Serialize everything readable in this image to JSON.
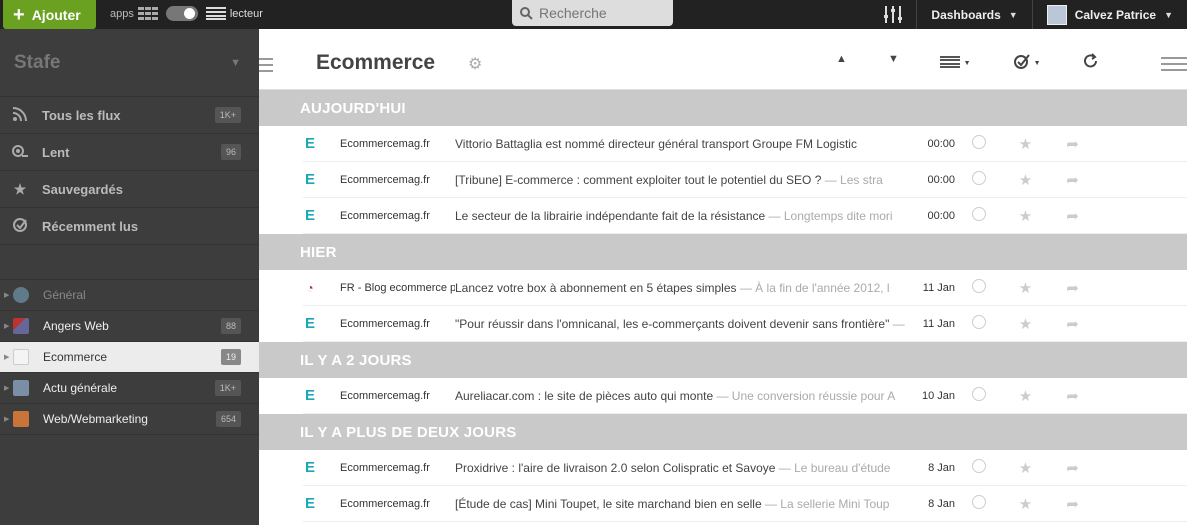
{
  "topbar": {
    "add_label": "Ajouter",
    "apps_label": "apps",
    "reader_label": "lecteur",
    "search_placeholder": "Recherche",
    "dashboards_label": "Dashboards",
    "user_name": "Calvez Patrice"
  },
  "sidebar": {
    "title": "Stafe",
    "nav": [
      {
        "label": "Tous les flux",
        "count": "1K+",
        "icon": "rss-icon"
      },
      {
        "label": "Lent",
        "count": "96",
        "icon": "snail-icon"
      },
      {
        "label": "Sauvegardés",
        "count": "",
        "icon": "star-icon"
      },
      {
        "label": "Récemment lus",
        "count": "",
        "icon": "read-check-icon"
      }
    ],
    "feeds": [
      {
        "label": "Général",
        "count": ""
      },
      {
        "label": "Angers Web",
        "count": "88"
      },
      {
        "label": "Ecommerce",
        "count": "19"
      },
      {
        "label": "Actu générale",
        "count": "1K+"
      },
      {
        "label": "Web/Webmarketing",
        "count": "654"
      }
    ]
  },
  "main": {
    "title": "Ecommerce",
    "sections": [
      {
        "label": "AUJOURD'HUI",
        "rows": [
          {
            "source": "Ecommercemag.fr",
            "title": "Vittorio Battaglia est nommé directeur général transport Groupe FM Logistic",
            "summary": "",
            "time": "00:00"
          },
          {
            "source": "Ecommercemag.fr",
            "title": "[Tribune] E-commerce : comment exploiter tout le potentiel du SEO ?",
            "summary": " — Les stra",
            "time": "00:00"
          },
          {
            "source": "Ecommercemag.fr",
            "title": "Le secteur de la librairie indépendante fait de la résistance",
            "summary": " — Longtemps dite mori",
            "time": "00:00"
          }
        ]
      },
      {
        "label": "HIER",
        "rows": [
          {
            "source": "FR - Blog ecommerce p",
            "title": "Lancez votre box à abonnement en 5 étapes simples",
            "summary": " — À la fin de l'année 2012, l",
            "time": "11 Jan"
          },
          {
            "source": "Ecommercemag.fr",
            "title": "\"Pour réussir dans l'omnicanal, les e-commerçants doivent devenir sans frontière\"",
            "summary": " —",
            "time": "11 Jan"
          }
        ]
      },
      {
        "label": "IL Y A 2 JOURS",
        "rows": [
          {
            "source": "Ecommercemag.fr",
            "title": "Aureliacar.com : le site de pièces auto qui monte",
            "summary": " — Une conversion réussie pour A",
            "time": "10 Jan"
          }
        ]
      },
      {
        "label": "IL Y A PLUS DE DEUX JOURS",
        "rows": [
          {
            "source": "Ecommercemag.fr",
            "title": "Proxidrive : l'aire de livraison 2.0 selon Colispratic et Savoye",
            "summary": " — Le bureau d'étude",
            "time": "8 Jan"
          },
          {
            "source": "Ecommercemag.fr",
            "title": "[Étude de cas] Mini Toupet, le site marchand bien en selle",
            "summary": " — La sellerie Mini Toup",
            "time": "8 Jan"
          }
        ]
      }
    ]
  },
  "colors": {
    "accent_green": "#6aa121",
    "source_icon": "#1da7b7",
    "section_bg": "#c9c9c9"
  }
}
